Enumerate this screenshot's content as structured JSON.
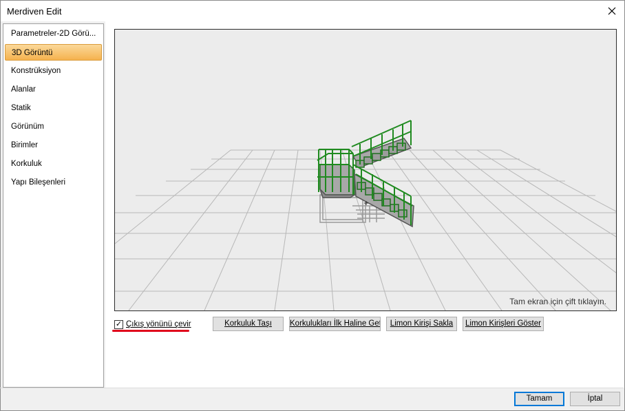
{
  "window": {
    "title": "Merdiven Edit"
  },
  "sidebar": {
    "items": [
      {
        "label": "Parametreler-2D Görü..."
      },
      {
        "label": "3D Görüntü",
        "active": true
      },
      {
        "label": "Konstrüksiyon"
      },
      {
        "label": "Alanlar"
      },
      {
        "label": "Statik"
      },
      {
        "label": "Görünüm"
      },
      {
        "label": "Birimler"
      },
      {
        "label": "Korkuluk"
      },
      {
        "label": "Yapı Bileşenleri"
      }
    ]
  },
  "viewport": {
    "hint": "Tam ekran için çift tıklayın."
  },
  "options": {
    "flip_exit_label": "Çıkış yönünü çevir",
    "flip_exit_checked": true
  },
  "actions": {
    "move_railing": "Korkuluk Taşı",
    "reset_railings": "Korkulukları İlk Haline Getir",
    "hide_stringer": "Limon Kirişi Sakla",
    "show_stringers": "Limon Kirişleri Göster"
  },
  "footer": {
    "ok": "Tamam",
    "cancel": "İptal"
  },
  "colors": {
    "accent": "#f5b24e",
    "railing": "#1f8a1f",
    "focus": "#0078d7",
    "annotation": "#e0001a"
  },
  "icons": {
    "close": "close-icon",
    "checkbox": "check-icon"
  }
}
